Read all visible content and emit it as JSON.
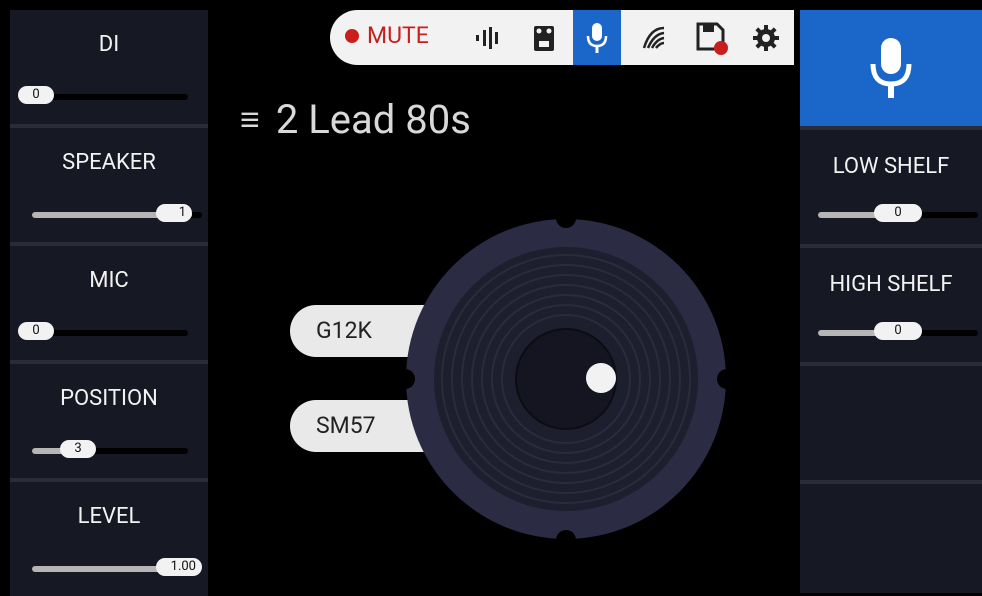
{
  "left_params": [
    {
      "label": "DI",
      "value": "0",
      "fill": 0.0
    },
    {
      "label": "SPEAKER",
      "value": "1",
      "fill": 1.0
    },
    {
      "label": "MIC",
      "value": "0",
      "fill": 0.0
    },
    {
      "label": "POSITION",
      "value": "3",
      "fill": 0.4
    },
    {
      "label": "LEVEL",
      "value": "1.00",
      "fill": 1.0
    }
  ],
  "right_params": [
    {
      "label": "LOW SHELF",
      "value": "0",
      "fill": 0.5
    },
    {
      "label": "HIGH SHELF",
      "value": "0",
      "fill": 0.5
    }
  ],
  "topbar": {
    "mute_label": "MUTE",
    "icons": [
      "tuner-icon",
      "pedal-icon",
      "mic-icon",
      "ir-icon",
      "save-icon",
      "settings-icon"
    ],
    "active_icon": "mic-icon"
  },
  "preset": {
    "name": "2 Lead 80s"
  },
  "speaker_options": {
    "speaker": "G12K",
    "mic": "SM57"
  },
  "colors": {
    "accent": "#1b66c9",
    "mute": "#c81e1e",
    "panel": "#161824"
  }
}
